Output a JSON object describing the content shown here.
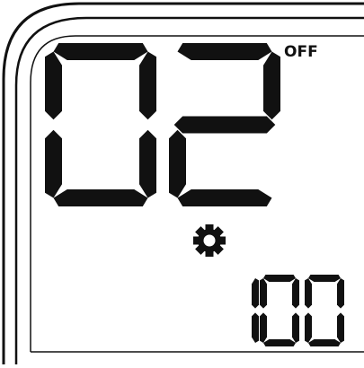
{
  "display": {
    "main_value": "02",
    "status_label": "OFF",
    "mode_icon": "gear-icon",
    "secondary_value": "100",
    "colors": {
      "segment": "#111111",
      "bezel": "#111111",
      "background": "#ffffff"
    }
  }
}
